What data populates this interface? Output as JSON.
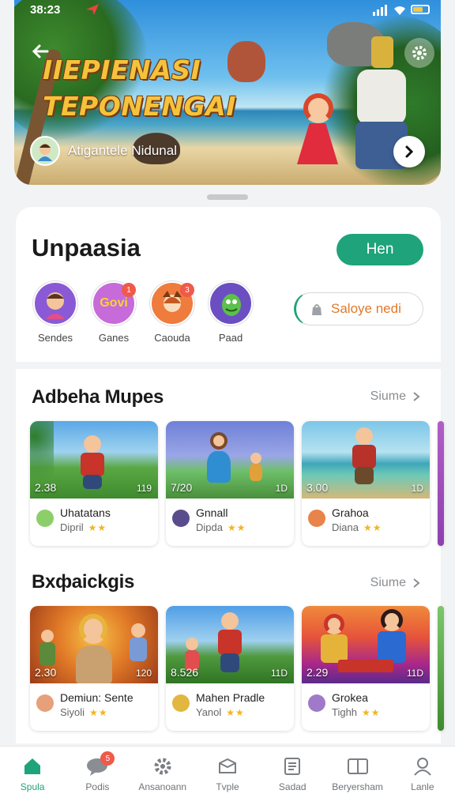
{
  "status_bar": {
    "time": "38:23"
  },
  "hero": {
    "title_line1": "IIEPIENASI",
    "title_line2": "TEPONENGAI",
    "author_name": "Atigantele Nidunal"
  },
  "section1": {
    "title": "Unpaasia",
    "action_label": "Hen",
    "categories": [
      {
        "label": "Sendes",
        "badge": "",
        "color": "#8a5ad6",
        "glyph": "☺"
      },
      {
        "label": "Ganes",
        "badge": "1",
        "color": "#c66bd9",
        "glyph": "Govi"
      },
      {
        "label": "Caouda",
        "badge": "3",
        "color": "#ef7b3d",
        "glyph": "★"
      },
      {
        "label": "Paad",
        "badge": "",
        "color": "#6b4fc2",
        "glyph": "✦"
      }
    ],
    "chip_label": "Saloye nedi"
  },
  "section2": {
    "title": "Adbeha Mupes",
    "more_label": "Siume",
    "items": [
      {
        "duration": "2.38",
        "count": "119",
        "title": "Uhatatans",
        "subtitle": "Dipril",
        "stars": "★★"
      },
      {
        "duration": "7/20",
        "count": "1D",
        "title": "Gnnall",
        "subtitle": "Dipda",
        "stars": "★★"
      },
      {
        "duration": "3.00",
        "count": "1D",
        "title": "Grahoa",
        "subtitle": "Diana",
        "stars": "★★"
      }
    ]
  },
  "section3": {
    "title": "Bxфaickgis",
    "more_label": "Siume",
    "items": [
      {
        "duration": "2.30",
        "count": "120",
        "title": "Demiun: Sente",
        "subtitle": "Siyoli",
        "stars": "★★"
      },
      {
        "duration": "8.526",
        "count": "11D",
        "title": "Mahen Pradle",
        "subtitle": "Yanol",
        "stars": "★★"
      },
      {
        "duration": "2.29",
        "count": "11D",
        "title": "Grokea",
        "subtitle": "Tighh",
        "stars": "★★"
      }
    ]
  },
  "bottom_nav": [
    {
      "label": "Spula",
      "icon": "home-icon",
      "active": true
    },
    {
      "label": "Podis",
      "icon": "chat-icon",
      "badge": "5"
    },
    {
      "label": "Ansanoann",
      "icon": "gear-icon"
    },
    {
      "label": "Tvple",
      "icon": "box-icon"
    },
    {
      "label": "Sadad",
      "icon": "document-icon"
    },
    {
      "label": "Beryersham",
      "icon": "book-icon"
    },
    {
      "label": "Lanle",
      "icon": "profile-icon"
    }
  ],
  "accent_color": "#1fa37a"
}
